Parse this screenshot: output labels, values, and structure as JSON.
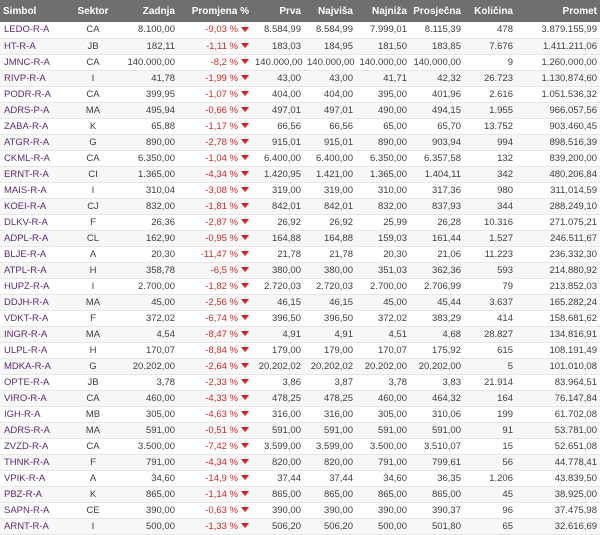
{
  "table": {
    "headers": {
      "symbol": "Simbol",
      "sector": "Sektor",
      "last": "Zadnja",
      "change": "Promjena %",
      "first": "Prva",
      "high": "Najviša",
      "low": "Najniža",
      "average": "Prosječna",
      "quantity": "Količina",
      "turnover": "Promet"
    },
    "colors": {
      "symbol": "#5b2a72",
      "change": "#cc2a2a",
      "arrow": "#d11f1f",
      "header_bg": "#6f6f6f"
    },
    "rows": [
      [
        "LEDO-R-A",
        "CA",
        "8.100,00",
        "-9,03 %",
        "8.584,99",
        "8.584,99",
        "7.999,01",
        "8.115,39",
        "478",
        "3.879.155,99"
      ],
      [
        "HT-R-A",
        "JB",
        "182,11",
        "-1,11 %",
        "183,03",
        "184,95",
        "181,50",
        "183,85",
        "7.676",
        "1.411.211,06"
      ],
      [
        "JMNC-R-A",
        "CA",
        "140.000,00",
        "-8,2 %",
        "140.000,00",
        "140.000,00",
        "140.000,00",
        "140.000,00",
        "9",
        "1.260.000,00"
      ],
      [
        "RIVP-R-A",
        "I",
        "41,78",
        "-1,99 %",
        "43,00",
        "43,00",
        "41,71",
        "42,32",
        "26.723",
        "1.130.874,60"
      ],
      [
        "PODR-R-A",
        "CA",
        "399,95",
        "-1,07 %",
        "404,00",
        "404,00",
        "395,00",
        "401,96",
        "2.616",
        "1.051.536,32"
      ],
      [
        "ADRS-P-A",
        "MA",
        "495,94",
        "-0,66 %",
        "497,01",
        "497,01",
        "490,00",
        "494,15",
        "1.955",
        "966.057,56"
      ],
      [
        "ZABA-R-A",
        "K",
        "65,88",
        "-1,17 %",
        "66,56",
        "66,56",
        "65,00",
        "65,70",
        "13.752",
        "903.460,45"
      ],
      [
        "ATGR-R-A",
        "G",
        "890,00",
        "-2,78 %",
        "915,01",
        "915,01",
        "890,00",
        "903,94",
        "994",
        "898.516,39"
      ],
      [
        "CKML-R-A",
        "CA",
        "6.350,00",
        "-1,04 %",
        "6.400,00",
        "6.400,00",
        "6.350,00",
        "6.357,58",
        "132",
        "839.200,00"
      ],
      [
        "ERNT-R-A",
        "CI",
        "1.365,00",
        "-4,34 %",
        "1.420,95",
        "1.421,00",
        "1.365,00",
        "1.404,11",
        "342",
        "480.206,84"
      ],
      [
        "MAIS-R-A",
        "I",
        "310,04",
        "-3,08 %",
        "319,00",
        "319,00",
        "310,00",
        "317,36",
        "980",
        "311.014,59"
      ],
      [
        "KOEI-R-A",
        "CJ",
        "832,00",
        "-1,81 %",
        "842,01",
        "842,01",
        "832,00",
        "837,93",
        "344",
        "288.249,10"
      ],
      [
        "DLKV-R-A",
        "F",
        "26,36",
        "-2,87 %",
        "26,92",
        "26,92",
        "25,99",
        "26,28",
        "10.316",
        "271.075,21"
      ],
      [
        "ADPL-R-A",
        "CL",
        "162,90",
        "-0,95 %",
        "164,88",
        "164,88",
        "159,03",
        "161,44",
        "1.527",
        "246.511,67"
      ],
      [
        "BLJE-R-A",
        "A",
        "20,30",
        "-11,47 %",
        "21,78",
        "21,78",
        "20,30",
        "21,06",
        "11.223",
        "236.332,30"
      ],
      [
        "ATPL-R-A",
        "H",
        "358,78",
        "-6,5 %",
        "380,00",
        "380,00",
        "351,03",
        "362,36",
        "593",
        "214.880,92"
      ],
      [
        "HUPZ-R-A",
        "I",
        "2.700,00",
        "-1,82 %",
        "2.720,03",
        "2.720,03",
        "2.700,00",
        "2.706,99",
        "79",
        "213.852,03"
      ],
      [
        "DDJH-R-A",
        "MA",
        "45,00",
        "-2,56 %",
        "46,15",
        "46,15",
        "45,00",
        "45,44",
        "3.637",
        "165.282,24"
      ],
      [
        "VDKT-R-A",
        "F",
        "372,02",
        "-6,74 %",
        "396,50",
        "396,50",
        "372,02",
        "383,29",
        "414",
        "158.681,62"
      ],
      [
        "INGR-R-A",
        "MA",
        "4,54",
        "-8,47 %",
        "4,91",
        "4,91",
        "4,51",
        "4,68",
        "28.827",
        "134.816,91"
      ],
      [
        "ULPL-R-A",
        "H",
        "170,07",
        "-8,84 %",
        "179,00",
        "179,00",
        "170,07",
        "175,92",
        "615",
        "108.191,49"
      ],
      [
        "MDKA-R-A",
        "G",
        "20.202,00",
        "-2,64 %",
        "20.202,02",
        "20.202,02",
        "20.202,00",
        "20.202,00",
        "5",
        "101.010,08"
      ],
      [
        "OPTE-R-A",
        "JB",
        "3,78",
        "-2,33 %",
        "3,86",
        "3,87",
        "3,78",
        "3,83",
        "21.914",
        "83.964,51"
      ],
      [
        "VIRO-R-A",
        "CA",
        "460,00",
        "-4,33 %",
        "478,25",
        "478,25",
        "460,00",
        "464,32",
        "164",
        "76.147,84"
      ],
      [
        "IGH-R-A",
        "MB",
        "305,00",
        "-4,63 %",
        "316,00",
        "316,00",
        "305,00",
        "310,06",
        "199",
        "61.702,08"
      ],
      [
        "ADRS-R-A",
        "MA",
        "591,00",
        "-0,51 %",
        "591,00",
        "591,00",
        "591,00",
        "591,00",
        "91",
        "53.781,00"
      ],
      [
        "ZVZD-R-A",
        "CA",
        "3.500,00",
        "-7,42 %",
        "3.599,00",
        "3.599,00",
        "3.500,00",
        "3.510,07",
        "15",
        "52.651,08"
      ],
      [
        "THNK-R-A",
        "F",
        "791,00",
        "-4,34 %",
        "820,00",
        "820,00",
        "791,00",
        "799,61",
        "56",
        "44.778,41"
      ],
      [
        "VPIK-R-A",
        "A",
        "34,60",
        "-14,9 %",
        "37,44",
        "37,44",
        "34,60",
        "36,35",
        "1.206",
        "43.839,50"
      ],
      [
        "PBZ-R-A",
        "K",
        "865,00",
        "-1,14 %",
        "865,00",
        "865,00",
        "865,00",
        "865,00",
        "45",
        "38.925,00"
      ],
      [
        "SAPN-R-A",
        "CE",
        "390,00",
        "-0,63 %",
        "390,00",
        "390,00",
        "390,00",
        "390,37",
        "96",
        "37.475,98"
      ],
      [
        "ARNT-R-A",
        "I",
        "500,00",
        "-1,33 %",
        "506,20",
        "506,20",
        "500,00",
        "501,80",
        "65",
        "32.616,69"
      ]
    ]
  }
}
